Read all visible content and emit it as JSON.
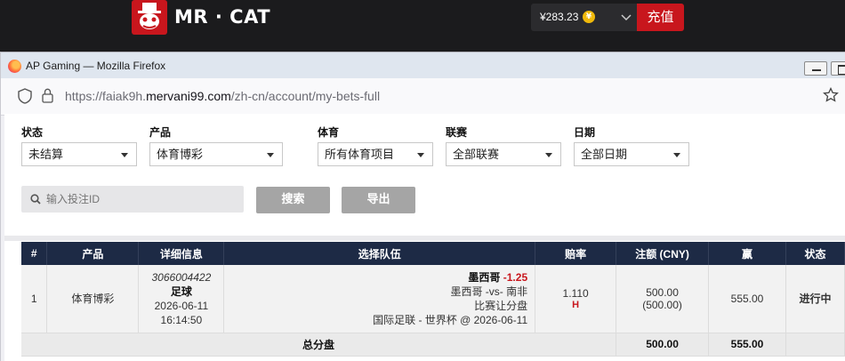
{
  "site": {
    "brand": "MR · CAT",
    "balance": "¥283.23",
    "coin_symbol": "¥",
    "topup_label": "充值"
  },
  "browser": {
    "window_title": "AP Gaming — Mozilla Firefox",
    "url_prefix": "https://faiak9h.",
    "url_domain": "mervani99.com",
    "url_path": "/zh-cn/account/my-bets-full"
  },
  "filters": [
    {
      "label": "状态",
      "value": "未结算"
    },
    {
      "label": "产品",
      "value": "体育博彩"
    },
    {
      "label": "体育",
      "value": "所有体育项目"
    },
    {
      "label": "联赛",
      "value": "全部联赛"
    },
    {
      "label": "日期",
      "value": "全部日期"
    }
  ],
  "search": {
    "placeholder": "输入投注ID",
    "search_label": "搜索",
    "export_label": "导出"
  },
  "table": {
    "headers": [
      "#",
      "产品",
      "详细信息",
      "选择队伍",
      "赔率",
      "注额 (CNY)",
      "赢",
      "状态"
    ],
    "row": {
      "index": "1",
      "product": "体育博彩",
      "bet_id": "3066004422",
      "sport": "足球",
      "date": "2026-06-11",
      "time": "16:14:50",
      "team": "墨西哥",
      "handicap": "-1.25",
      "match": "墨西哥 -vs- 南非",
      "market": "比赛让分盘",
      "league": "国际足联 - 世界杯 @ 2026-06-11",
      "odds": "1.110",
      "odds_type": "H",
      "stake": "500.00",
      "stake_paren": "(500.00)",
      "win": "555.00",
      "status": "进行中"
    },
    "total": {
      "label": "总分盘",
      "stake": "500.00",
      "win": "555.00"
    }
  },
  "colors": {
    "brand_red": "#c8161d",
    "table_header": "#1d2a45",
    "status_running": "#e0400c"
  }
}
